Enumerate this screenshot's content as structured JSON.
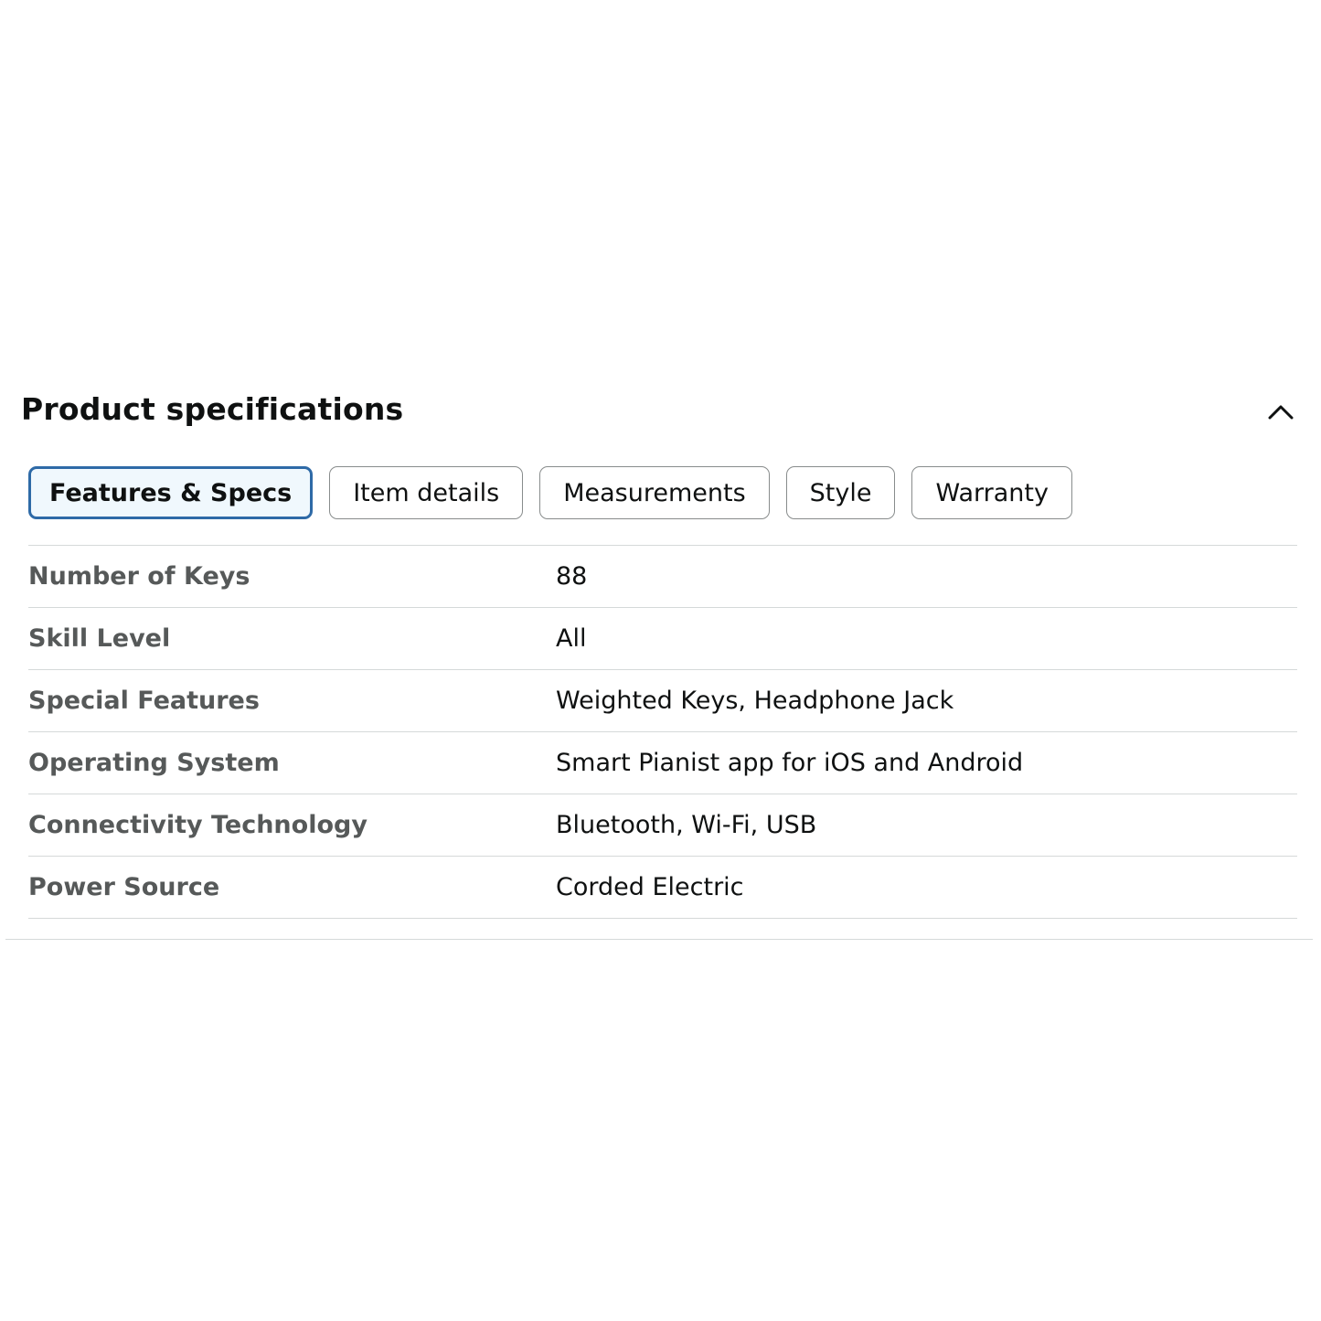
{
  "section": {
    "title": "Product specifications",
    "collapse_icon": "chevron-up-icon"
  },
  "tabs": [
    {
      "label": "Features & Specs",
      "active": true
    },
    {
      "label": "Item details",
      "active": false
    },
    {
      "label": "Measurements",
      "active": false
    },
    {
      "label": "Style",
      "active": false
    },
    {
      "label": "Warranty",
      "active": false
    }
  ],
  "specs": [
    {
      "label": "Number of Keys",
      "value": "88"
    },
    {
      "label": "Skill Level",
      "value": "All"
    },
    {
      "label": "Special Features",
      "value": "Weighted Keys, Headphone Jack"
    },
    {
      "label": "Operating System",
      "value": "Smart Pianist app for iOS and Android"
    },
    {
      "label": "Connectivity Technology",
      "value": "Bluetooth, Wi-Fi, USB"
    },
    {
      "label": "Power Source",
      "value": "Corded Electric"
    }
  ],
  "colors": {
    "active_tab_border": "#2e6aa7",
    "active_tab_background": "#f0f8fd",
    "label_text": "#565959",
    "value_text": "#0f1111",
    "divider": "#d5d9d9"
  }
}
